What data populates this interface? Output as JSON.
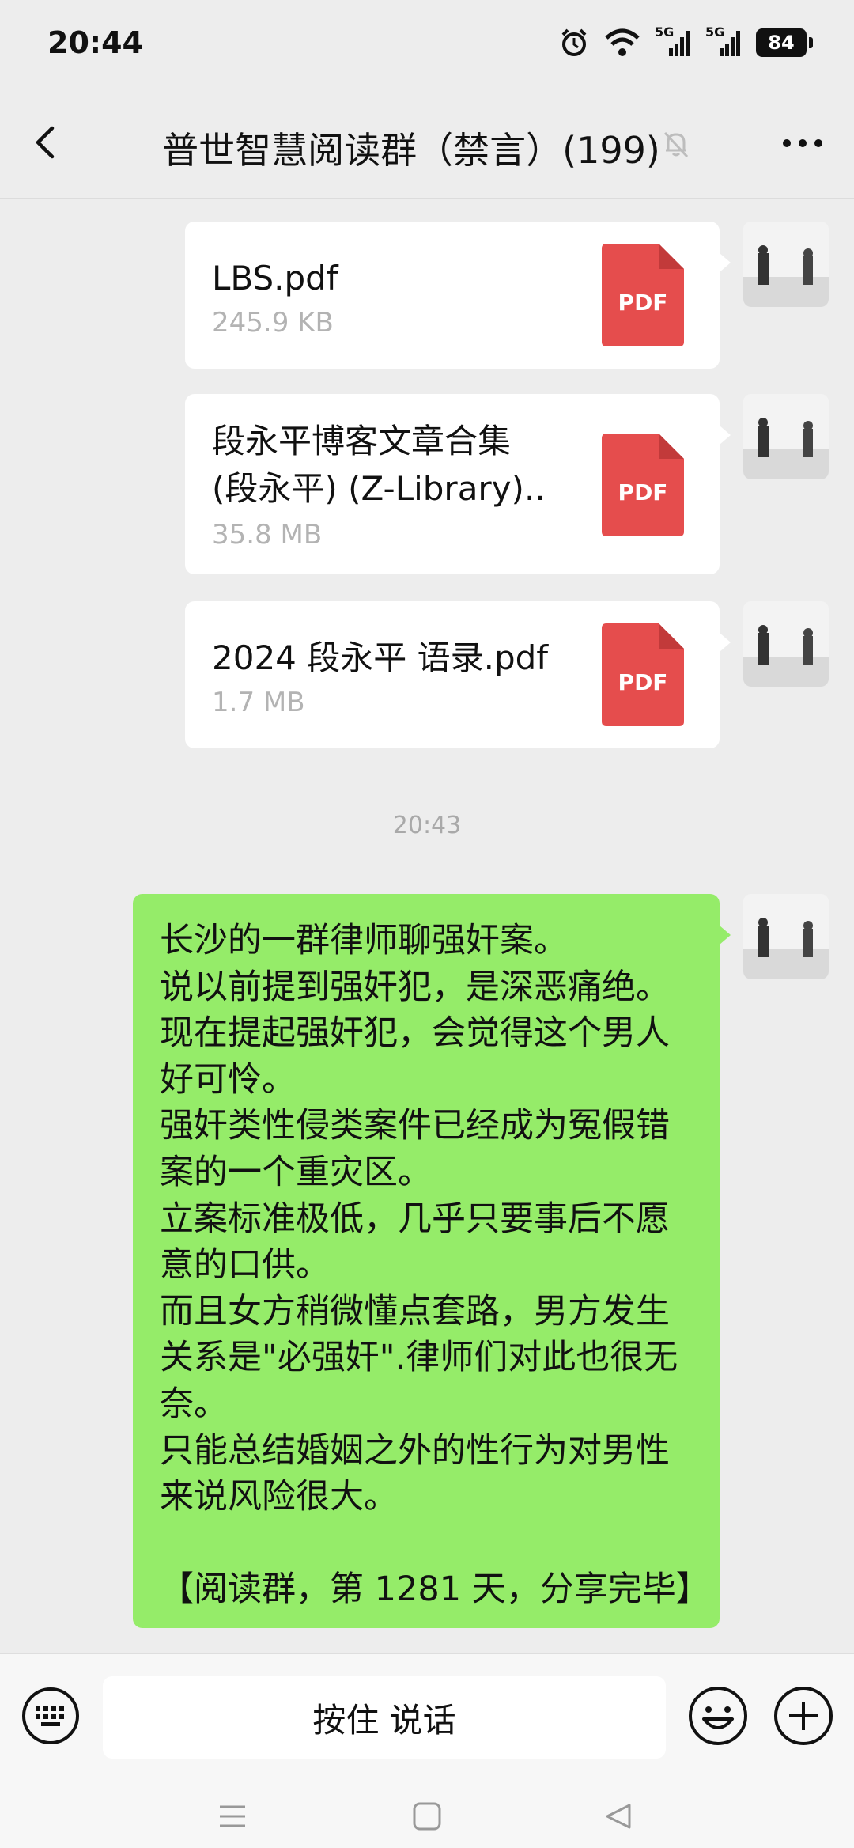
{
  "status_bar": {
    "time": "20:44",
    "network_1": "5G",
    "network_2": "5G",
    "battery": "84"
  },
  "header": {
    "title": "普世智慧阅读群（禁言）(199)"
  },
  "files": [
    {
      "name_lines": [
        "LBS.pdf"
      ],
      "size": "245.9 KB",
      "icon_label": "PDF"
    },
    {
      "name_lines": [
        "段永平博客文章合集",
        "(段永平) (Z-Library).."
      ],
      "size": "35.8 MB",
      "icon_label": "PDF"
    },
    {
      "name_lines": [
        "2024 段永平 语录.pdf"
      ],
      "size": "1.7 MB",
      "icon_label": "PDF"
    }
  ],
  "timestamp": "20:43",
  "message": {
    "lines": [
      "长沙的一群律师聊强奸案。",
      "说以前提到强奸犯，是深恶痛绝。",
      "现在提起强奸犯，会觉得这个男人",
      "好可怜。",
      "强奸类性侵类案件已经成为冤假错",
      "案的一个重灾区。",
      "立案标准极低，几乎只要事后不愿",
      "意的口供。",
      "而且女方稍微懂点套路，男方发生",
      "关系是\"必强奸\".律师们对此也很无",
      "奈。",
      "只能总结婚姻之外的性行为对男性",
      "来说风险很大。",
      "",
      "【阅读群，第 1281 天，分享完毕】"
    ]
  },
  "input_bar": {
    "hold_to_talk": "按住 说话"
  },
  "colors": {
    "background": "#ededed",
    "bubble_green": "#95ec69",
    "pdf_red": "#e54d4d",
    "muted_text": "#b3b3b3"
  }
}
